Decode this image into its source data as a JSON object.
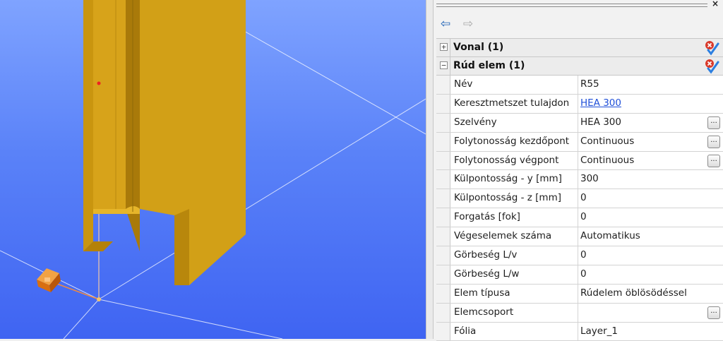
{
  "panel": {
    "close_label": "×",
    "nav": {
      "back_icon": "arrow-left-icon",
      "forward_icon": "arrow-right-icon",
      "back_glyph": "⇦",
      "forward_glyph": "⇨"
    },
    "groups": [
      {
        "title": "Vonal (1)",
        "expander": "+",
        "status_icon": "status-ok-icon"
      },
      {
        "title": "Rúd elem (1)",
        "expander": "−",
        "status_icon": "status-ok-icon"
      }
    ],
    "properties": [
      {
        "name": "Név",
        "value": "R55"
      },
      {
        "name": "Keresztmetszet tulajdon",
        "value": "HEA 300"
      },
      {
        "name": "Szelvény",
        "value": "HEA 300"
      },
      {
        "name": "Folytonosság kezdőpont",
        "value": "Continuous"
      },
      {
        "name": "Folytonosság végpont",
        "value": "Continuous"
      },
      {
        "name": "Külpontosság - y [mm]",
        "value": "300"
      },
      {
        "name": "Külpontosság - z [mm]",
        "value": "0"
      },
      {
        "name": "Forgatás [fok]",
        "value": "0"
      },
      {
        "name": "Végeselemek száma",
        "value": "Automatikus"
      },
      {
        "name": "Görbeség L/v",
        "value": "0"
      },
      {
        "name": "Görbeség L/w",
        "value": "0"
      },
      {
        "name": "Elem típusa",
        "value": "Rúdelem öblösödéssel"
      },
      {
        "name": "Elemcsoport",
        "value": ""
      },
      {
        "name": "Fólia",
        "value": "Layer_1"
      }
    ],
    "ellipsis_label": "...",
    "colors": {
      "link": "#1f4fd8",
      "beam": "#d4a017",
      "viewport_bg": "#5a82f8",
      "support": "#e87a1a"
    }
  }
}
